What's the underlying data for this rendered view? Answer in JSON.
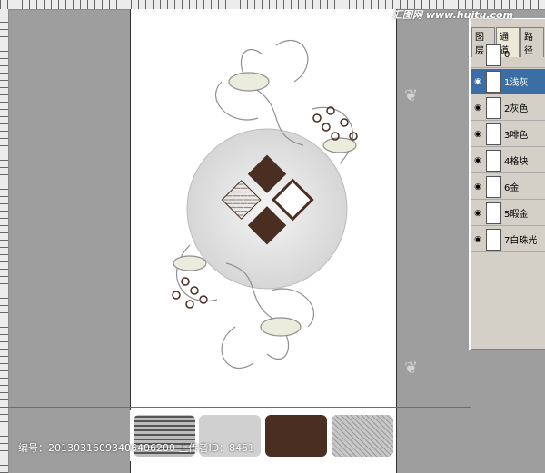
{
  "watermark": {
    "brand": "汇图网 www.huitu.com",
    "footer": "编号：20130316093406406200 上传者ID：8451"
  },
  "panel": {
    "tabs": [
      "图层",
      "通道",
      "路径"
    ],
    "active_tab": 1,
    "layers": [
      {
        "name": "0",
        "visible": false,
        "selected": false
      },
      {
        "name": "1浅灰",
        "visible": true,
        "selected": true
      },
      {
        "name": "2灰色",
        "visible": true,
        "selected": false
      },
      {
        "name": "3啡色",
        "visible": true,
        "selected": false
      },
      {
        "name": "4格块",
        "visible": true,
        "selected": false
      },
      {
        "name": "6金",
        "visible": true,
        "selected": false
      },
      {
        "name": "5暇金",
        "visible": true,
        "selected": false
      },
      {
        "name": "7白珠光",
        "visible": true,
        "selected": false
      }
    ]
  },
  "swatches": [
    {
      "name": "wave-pattern",
      "color": "#bdbdbd"
    },
    {
      "name": "floral-pattern",
      "color": "#d0d0d0"
    },
    {
      "name": "brown-solid",
      "color": "#4a2e22"
    },
    {
      "name": "net-pattern",
      "color": "#c8c8c8"
    }
  ]
}
